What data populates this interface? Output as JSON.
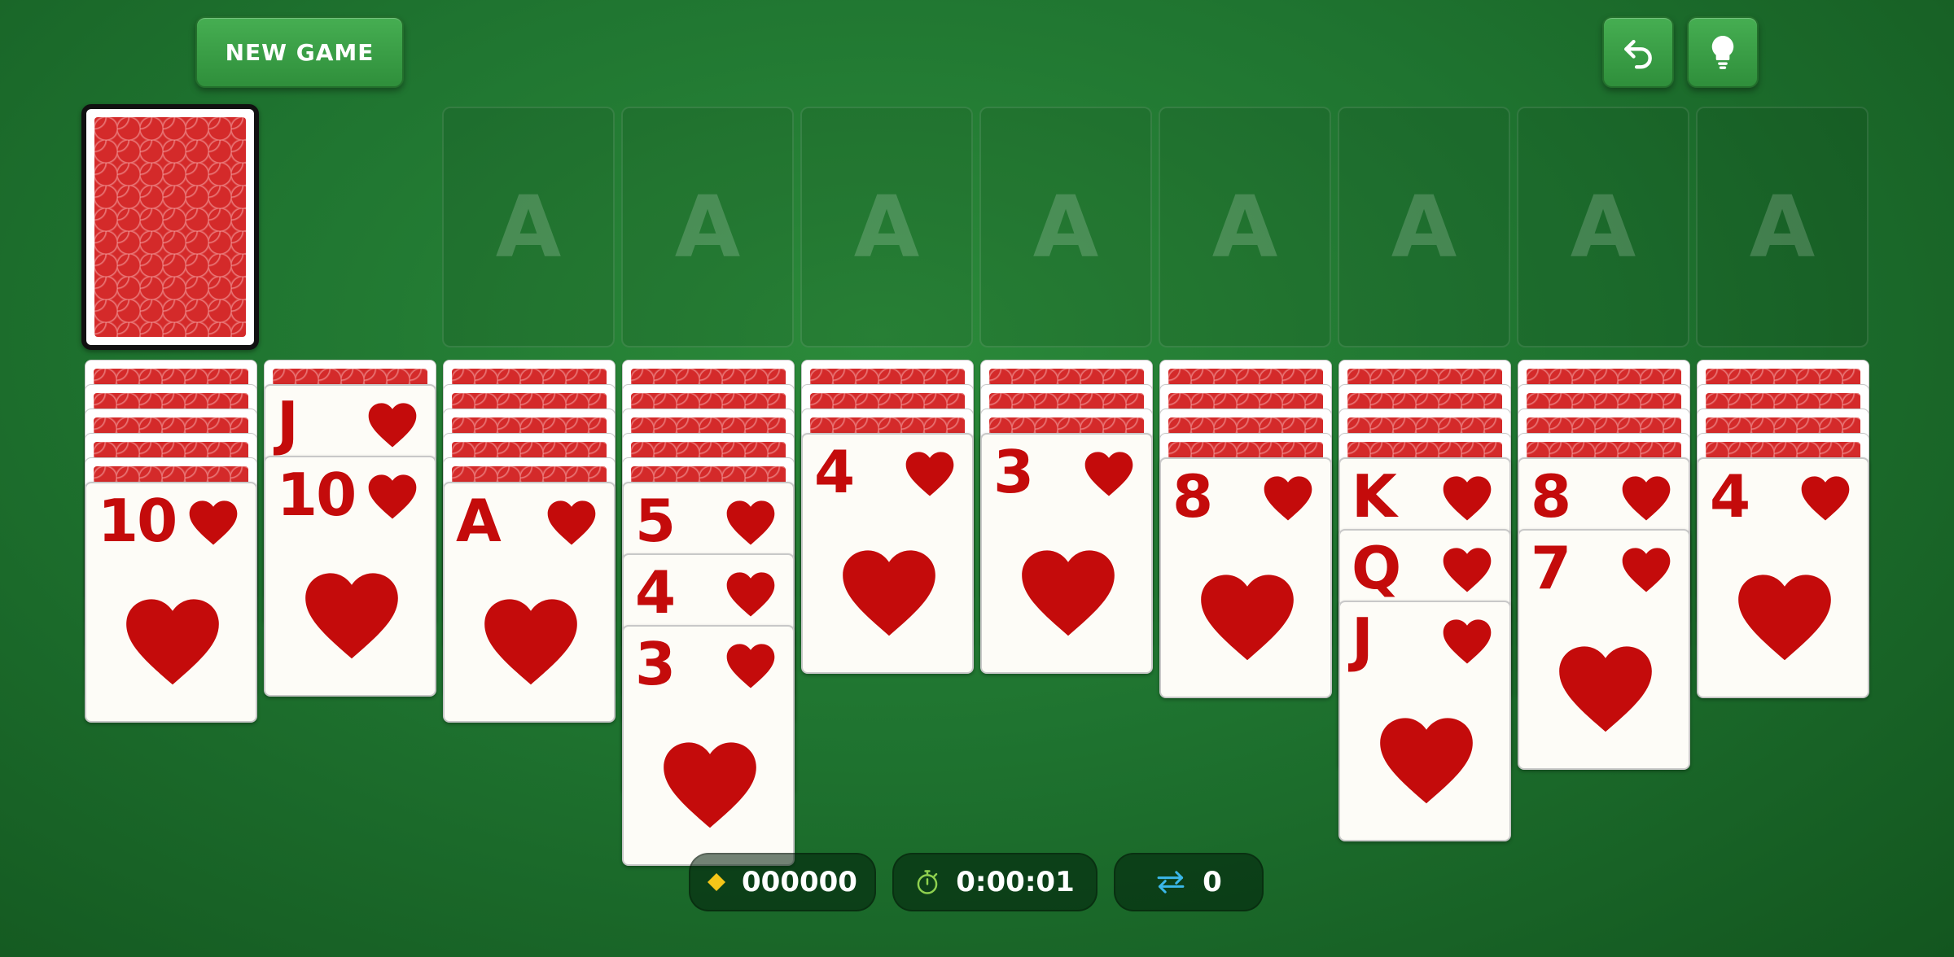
{
  "toolbar": {
    "new_game_label": "NEW GAME",
    "undo_icon": "undo-icon",
    "hint_icon": "lightbulb-icon"
  },
  "stock": {
    "card_back_icon": "card-back-pattern"
  },
  "foundations": [
    {
      "label": "A"
    },
    {
      "label": "A"
    },
    {
      "label": "A"
    },
    {
      "label": "A"
    },
    {
      "label": "A"
    },
    {
      "label": "A"
    },
    {
      "label": "A"
    },
    {
      "label": "A"
    }
  ],
  "tableau": [
    {
      "down": 5,
      "up": [
        {
          "rank": "10",
          "suit": "heart"
        }
      ]
    },
    {
      "down": 1,
      "up": [
        {
          "rank": "J",
          "suit": "heart"
        },
        {
          "rank": "10",
          "suit": "heart"
        }
      ]
    },
    {
      "down": 5,
      "up": [
        {
          "rank": "A",
          "suit": "heart"
        }
      ]
    },
    {
      "down": 5,
      "up": [
        {
          "rank": "5",
          "suit": "heart"
        },
        {
          "rank": "4",
          "suit": "heart"
        },
        {
          "rank": "3",
          "suit": "heart"
        }
      ]
    },
    {
      "down": 3,
      "up": [
        {
          "rank": "4",
          "suit": "heart"
        }
      ]
    },
    {
      "down": 3,
      "up": [
        {
          "rank": "3",
          "suit": "heart"
        }
      ]
    },
    {
      "down": 4,
      "up": [
        {
          "rank": "8",
          "suit": "heart"
        }
      ]
    },
    {
      "down": 4,
      "up": [
        {
          "rank": "K",
          "suit": "heart"
        },
        {
          "rank": "Q",
          "suit": "heart"
        },
        {
          "rank": "J",
          "suit": "heart"
        }
      ]
    },
    {
      "down": 4,
      "up": [
        {
          "rank": "8",
          "suit": "heart"
        },
        {
          "rank": "7",
          "suit": "heart"
        }
      ]
    },
    {
      "down": 4,
      "up": [
        {
          "rank": "4",
          "suit": "heart"
        }
      ]
    }
  ],
  "status": {
    "score_icon": "diamond-icon",
    "score": "000000",
    "time_icon": "stopwatch-icon",
    "time": "0:00:01",
    "moves_icon": "swap-arrows-icon",
    "moves": "0"
  },
  "colors": {
    "felt": "#1f7430",
    "button": "#3a9f47",
    "red_suit": "#c40b0b",
    "card_face": "#fdfcf7",
    "card_back": "#d42a2a",
    "score_icon": "#f5c518",
    "time_icon": "#8fd14f",
    "moves_icon": "#3bb7e8"
  }
}
